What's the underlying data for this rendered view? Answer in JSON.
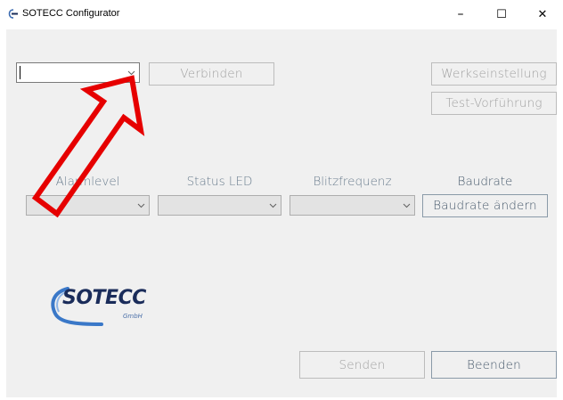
{
  "window": {
    "title": "SOTECC Configurator",
    "minimize_label": "–",
    "maximize_label": "☐",
    "close_label": "✕"
  },
  "connection": {
    "port_select_value": "",
    "connect_button": "Verbinden"
  },
  "top_right": {
    "factory_settings_button": "Werkseinstellung",
    "test_demo_button": "Test-Vorführung"
  },
  "settings": {
    "alarm_level_label": "Alarmlevel",
    "alarm_level_value": "",
    "status_led_label": "Status LED",
    "status_led_value": "",
    "flash_frequency_label": "Blitzfrequenz",
    "flash_frequency_value": "",
    "baud_rate_label": "Baudrate",
    "change_baud_button": "Baudrate ändern"
  },
  "logo": {
    "text": "SOTECC",
    "subtext": "GmbH"
  },
  "footer": {
    "send_button": "Senden",
    "exit_button": "Beenden"
  },
  "annotation": {
    "arrow_color": "#e60000"
  }
}
